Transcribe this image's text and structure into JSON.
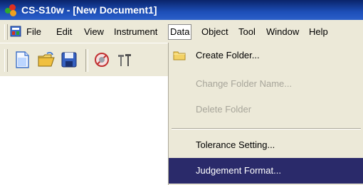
{
  "window": {
    "title": "CS-S10w - [New Document1]"
  },
  "menubar": {
    "items": [
      {
        "label": "File"
      },
      {
        "label": "Edit"
      },
      {
        "label": "View"
      },
      {
        "label": "Instrument"
      },
      {
        "label": "Data"
      },
      {
        "label": "Object"
      },
      {
        "label": "Tool"
      },
      {
        "label": "Window"
      },
      {
        "label": "Help"
      }
    ],
    "active": "Data"
  },
  "toolbar": {
    "buttons": [
      "new-document-icon",
      "open-folder-icon",
      "save-icon",
      "connect-icon",
      "tool-icon"
    ]
  },
  "data_menu": {
    "items": [
      {
        "label": "Create Folder...",
        "enabled": true,
        "icon": "folder-icon"
      },
      {
        "label": "Change Folder Name...",
        "enabled": false
      },
      {
        "label": "Delete Folder",
        "enabled": false
      },
      {
        "label": "Tolerance Setting...",
        "enabled": true
      },
      {
        "label": "Judgement Format...",
        "enabled": true,
        "highlighted": true
      }
    ]
  },
  "colors": {
    "titlebar": "#0a246a",
    "menu_bg": "#ece9d8",
    "highlight": "#2a2a6a",
    "disabled_text": "#a7a59a"
  }
}
